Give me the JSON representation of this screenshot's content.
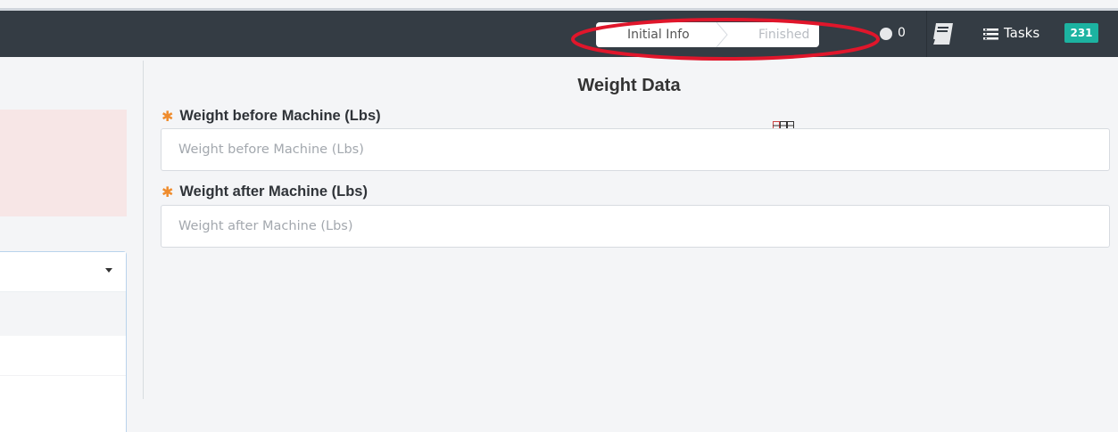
{
  "navbar": {
    "breadcrumb": {
      "steps": [
        "Initial Info",
        "Finished"
      ]
    },
    "messages": {
      "icon": "chat-bubble-icon",
      "count": "0"
    },
    "notebook": {
      "icon": "notebook-icon"
    },
    "tasks": {
      "icon": "list-icon",
      "label": "Tasks",
      "badge": "231",
      "badge_color": "#1cb3a1"
    }
  },
  "form": {
    "title": "Weight Data",
    "fields": [
      {
        "label": "Weight before Machine (Lbs)",
        "placeholder": "Weight before Machine (Lbs)",
        "value": "",
        "required": true
      },
      {
        "label": "Weight after Machine (Lbs)",
        "placeholder": "Weight after Machine (Lbs)",
        "value": "",
        "required": true
      }
    ],
    "required_marker": "✱"
  },
  "colors": {
    "navbar_bg": "#343c44",
    "required": "#ef8c2d",
    "annotation": "#e0162b",
    "alert_bg": "#f7e6e6"
  }
}
